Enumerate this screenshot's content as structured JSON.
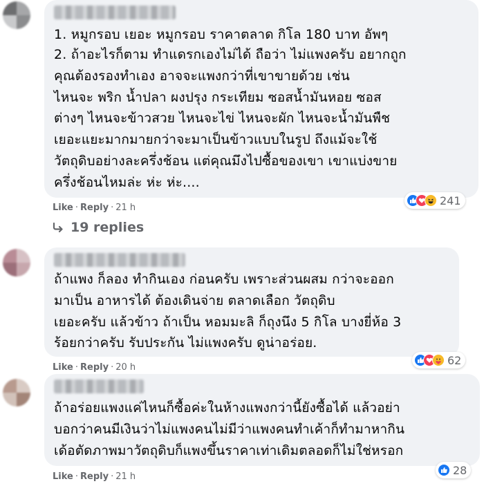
{
  "comments": [
    {
      "lines": [
        "1. หมูกรอบ เยอะ หมูกรอบ ราคาตลาด กิโล 180 บาท อัพๆ",
        "2. ถ้าอะไรก็ตาม ทำแดรกเองไม่ได้ ถือว่า ไม่แพงครับ อยากถูก",
        "คุณต้องรองทำเอง อาจจะแพงกว่าที่เขาขายด้วย เช่น",
        "ไหนจะ พริก น้ำปลา ผงปรุง กระเทียม ซอสน้ำมันหอย ซอส",
        "ต่างๆ ไหนจะข้าวสวย ไหนจะไข่ ไหนจะผัก ไหนจะน้ำมันพืช",
        "เยอะแยะมากมายกว่าจะมาเป็นข้าวแบบในรูป ถึงแม้จะใช้",
        "วัตถุดิบอย่างละครึ่งช้อน แต่คุณมึงไปซื้อของเขา เขาแบ่งขาย",
        "ครึ่งช้อนไหมล่ะ ห่ะ ห่ะ...."
      ],
      "like_label": "Like",
      "reply_label": "Reply",
      "time": "21 h",
      "reaction_icons": [
        "like-icon",
        "love-icon",
        "haha-icon"
      ],
      "reaction_count": "241",
      "replies_label": "19 replies"
    },
    {
      "lines": [
        "ถ้าแพง ก็ลอง ทำกินเอง ก่อนครับ เพราะส่วนผสม กว่าจะออก",
        "มาเป็น อาหารได้ ต้องเดินจ่าย ตลาดเลือก วัตถุดิบ",
        "เยอะครับ แล้วข้าว ถ้าเป็น หอมมะลิ ก็ถุงนึง 5 กิโล บางยี่ห้อ 3",
        "ร้อยกว่าครับ รับประกัน ไม่แพงครับ ดูน่าอร่อย."
      ],
      "like_label": "Like",
      "reply_label": "Reply",
      "time": "20 h",
      "reaction_icons": [
        "like-icon",
        "love-icon",
        "care-icon"
      ],
      "reaction_count": "62"
    },
    {
      "lines": [
        "ถ้าอร่อยแพงแค่ไหนก็ซื้อค่ะในห้างแพงกว่านี้ยังซื้อได้ แล้วอย่า",
        "บอกว่าคนมีเงินว่าไม่แพงคนไม่มีว่าแพงคนทำเค้าก็ทำมาหากิน",
        "เด้อตัดภาพมาวัตถุดิบก็แพงขึ้นราคาเท่าเดิมตลอดก็ไม่ใช่หรอก"
      ],
      "like_label": "Like",
      "reply_label": "Reply",
      "time": "21 h",
      "reaction_icons": [
        "like-icon"
      ],
      "reaction_count": "28"
    }
  ],
  "separator": "·",
  "colors": {
    "bubble": "#f0f2f5",
    "meta_text": "#65676b",
    "like_blue": "#1877f2",
    "love_red": "#f33e58",
    "haha_yellow": "#f7b928"
  }
}
